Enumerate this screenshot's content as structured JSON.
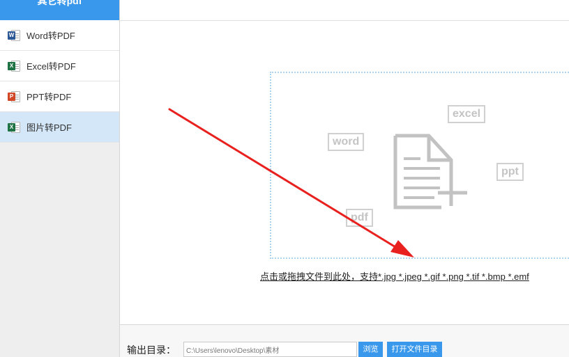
{
  "sidebar": {
    "title": "其它转pdf",
    "items": [
      {
        "label": "Word转PDF",
        "icon": "word-icon",
        "badge": "W",
        "color": "#2b5797"
      },
      {
        "label": "Excel转PDF",
        "icon": "excel-icon",
        "badge": "X",
        "color": "#1f7244"
      },
      {
        "label": "PPT转PDF",
        "icon": "ppt-icon",
        "badge": "P",
        "color": "#d24726"
      },
      {
        "label": "图片转PDF",
        "icon": "excel-icon",
        "badge": "X",
        "color": "#1f7244",
        "active": true
      }
    ]
  },
  "dropzone": {
    "tags": {
      "word": "word",
      "excel": "excel",
      "ppt": "ppt",
      "pdf": "pdf"
    },
    "hint": "点击或拖拽文件到此处，支持*.jpg *.jpeg *.gif *.png *.tif *.bmp *.emf"
  },
  "output": {
    "label": "输出目录：",
    "path": "C:\\Users\\lenovo\\Desktop\\素材",
    "browse_label": "浏览",
    "open_dir_label": "打开文件目录"
  },
  "colors": {
    "accent": "#3a98ec",
    "arrow": "#e8211f",
    "active_item": "#d4e7f8"
  }
}
